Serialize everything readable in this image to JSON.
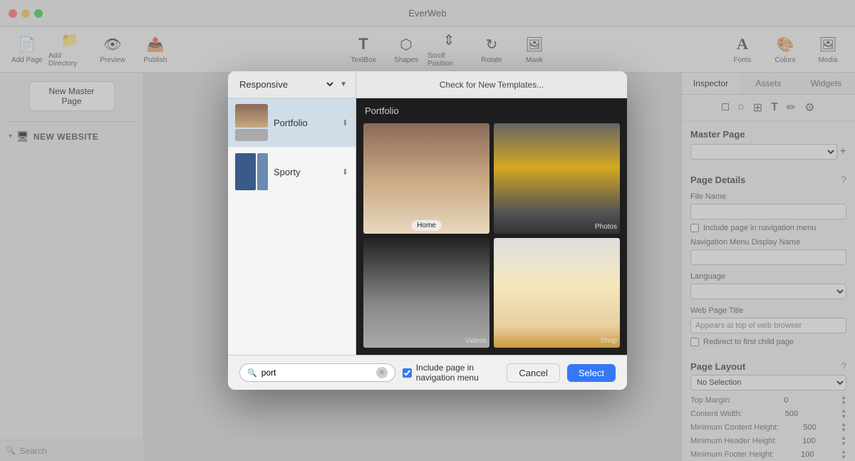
{
  "app": {
    "title": "EverWeb"
  },
  "titlebar": {
    "title": "EverWeb"
  },
  "toolbar": {
    "buttons": [
      {
        "label": "Add Page",
        "icon": "📄"
      },
      {
        "label": "Add Directory",
        "icon": "📁"
      },
      {
        "label": "Preview",
        "icon": "👁"
      },
      {
        "label": "Publish",
        "icon": "📤"
      }
    ],
    "right_buttons": [
      {
        "label": "Fonts",
        "icon": "A"
      },
      {
        "label": "Colors",
        "icon": "🎨"
      },
      {
        "label": "Media",
        "icon": "🖼"
      }
    ],
    "center_buttons": [
      {
        "label": "TextBox",
        "icon": "T"
      },
      {
        "label": "Shapes",
        "icon": "⬡"
      },
      {
        "label": "Scroll Position",
        "icon": "↕"
      },
      {
        "label": "Rotate",
        "icon": "↻"
      },
      {
        "label": "Mask",
        "icon": "🖼"
      }
    ]
  },
  "sidebar": {
    "new_master_label": "New Master Page",
    "tree_label": "NEW WEBSITE"
  },
  "search": {
    "placeholder": "Search",
    "value": ""
  },
  "inspector": {
    "tabs": [
      "Inspector",
      "Assets",
      "Widgets"
    ],
    "active_tab": "Inspector",
    "section_title": "Master Page",
    "page_details_title": "Page Details",
    "file_name_label": "File Name",
    "include_nav_label": "Include page in navigation menu",
    "nav_display_name_label": "Navigation Menu Display Name",
    "language_label": "Language",
    "web_page_title_label": "Web Page Title",
    "web_page_title_placeholder": "Appears at top of web browser",
    "redirect_label": "Redirect to first child page",
    "page_layout_label": "Page Layout",
    "page_layout_value": "No Selection",
    "top_margin_label": "Top Margin:",
    "top_margin_value": "0",
    "content_width_label": "Content Width:",
    "content_width_value": "500",
    "min_content_height_label": "Minimum Content Height:",
    "min_content_height_value": "500",
    "min_header_height_label": "Minimum Header Height:",
    "min_header_height_value": "100",
    "min_footer_height_label": "Minimum Footer Height:",
    "min_footer_height_value": "100"
  },
  "modal": {
    "dropdown_value": "Responsive",
    "check_label": "Check for New Templates...",
    "list_items": [
      {
        "label": "Portfolio",
        "selected": true
      },
      {
        "label": "Sporty",
        "selected": false
      }
    ],
    "preview_title": "Portfolio",
    "preview_cards": [
      {
        "label": "Home",
        "type": "portfolio",
        "position": "bottom-center"
      },
      {
        "label": "Photos",
        "type": "photos",
        "position": "bottom-right"
      },
      {
        "label": "Videos",
        "type": "videos",
        "position": "bottom-right"
      },
      {
        "label": "Shop",
        "type": "shop",
        "position": "bottom-right"
      }
    ],
    "search_value": "port",
    "include_nav_label": "Include page in navigation menu",
    "cancel_label": "Cancel",
    "select_label": "Select"
  }
}
